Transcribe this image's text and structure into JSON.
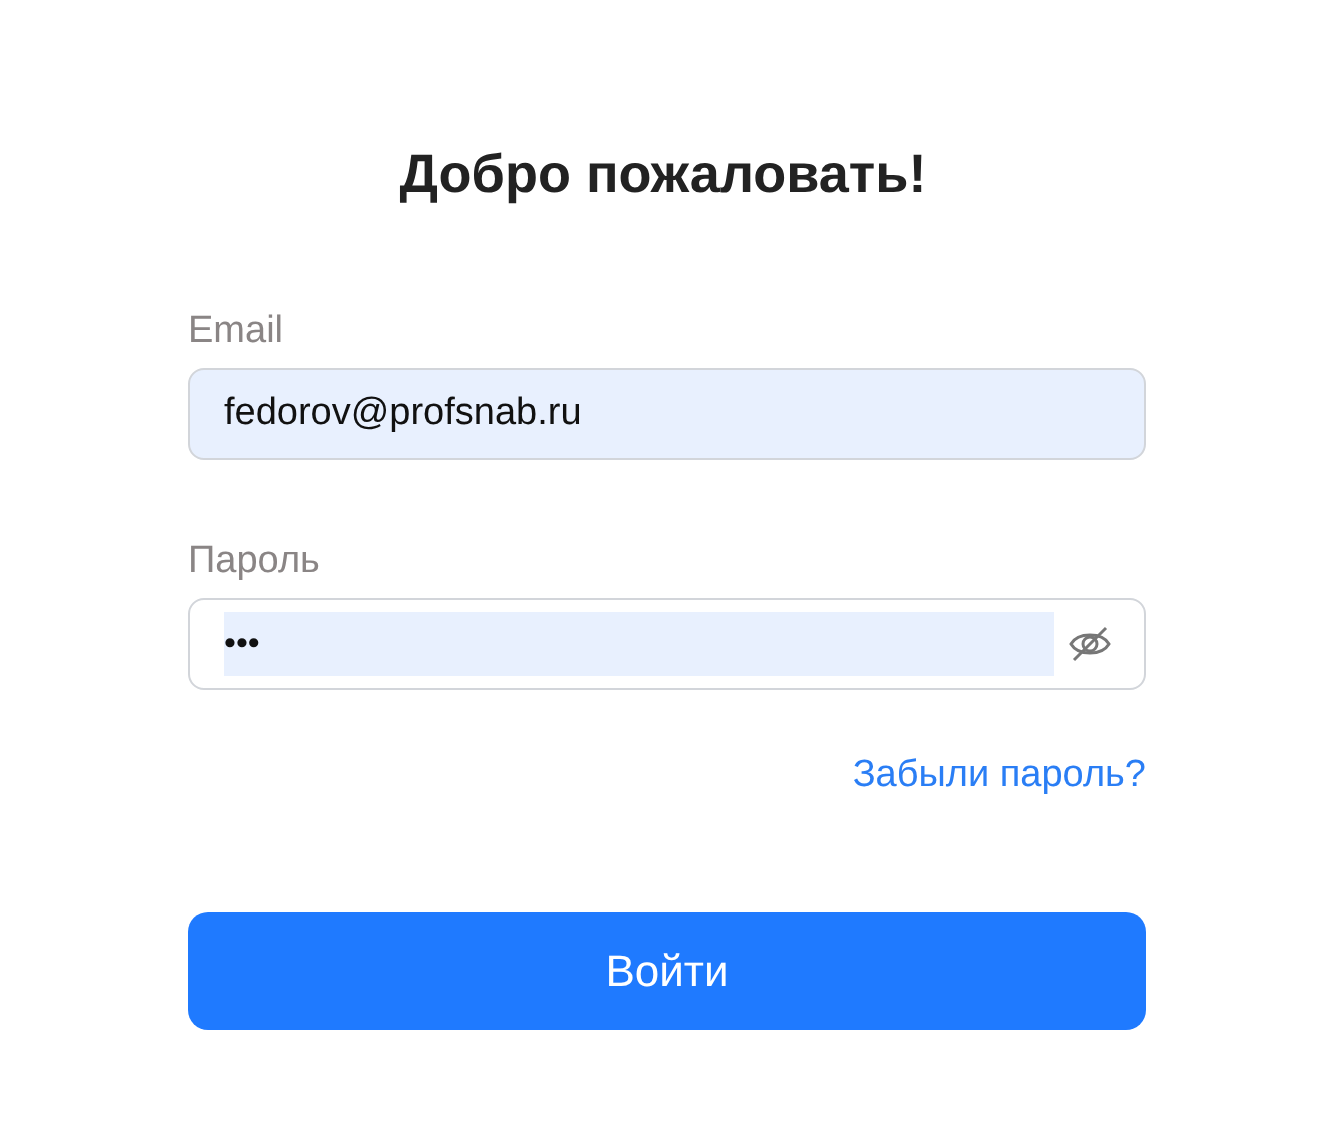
{
  "title": "Добро пожаловать!",
  "fields": [
    {
      "label": "Email",
      "value": "fedorov@profsnab.ru",
      "kind": "email"
    },
    {
      "label": "Пароль",
      "value": "•••",
      "kind": "password"
    }
  ],
  "forgot_link": "Забыли пароль?",
  "submit": "Войти"
}
